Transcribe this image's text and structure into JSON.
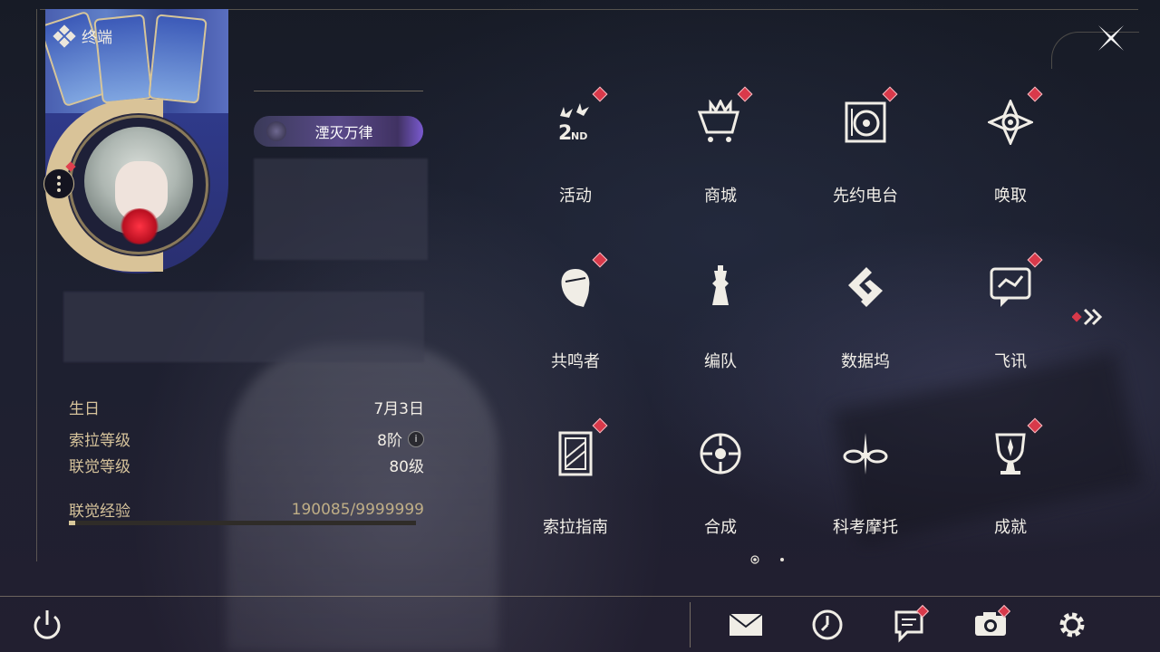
{
  "header": {
    "title": "终端"
  },
  "profile": {
    "title_badge": "湮灭万律",
    "stats": [
      {
        "label": "生日",
        "value": "7月3日"
      },
      {
        "label": "索拉等级",
        "value": "8阶"
      },
      {
        "label": "联觉等级",
        "value": "80级"
      },
      {
        "label": "联觉经验",
        "value": "190085/9999999"
      }
    ],
    "exp_progress_fraction": 0.019
  },
  "menu": {
    "items": [
      {
        "label": "活动",
        "icon": "activity-2nd-icon",
        "badge": true
      },
      {
        "label": "商城",
        "icon": "shop-cart-icon",
        "badge": true
      },
      {
        "label": "先约电台",
        "icon": "radio-station-icon",
        "badge": true
      },
      {
        "label": "唤取",
        "icon": "summon-compass-icon",
        "badge": true
      },
      {
        "label": "共鸣者",
        "icon": "resonator-portrait-icon",
        "badge": true
      },
      {
        "label": "编队",
        "icon": "team-chess-icon",
        "badge": false
      },
      {
        "label": "数据坞",
        "icon": "data-bank-icon",
        "badge": false
      },
      {
        "label": "飞讯",
        "icon": "chat-message-icon",
        "badge": true
      },
      {
        "label": "索拉指南",
        "icon": "guidebook-icon",
        "badge": true
      },
      {
        "label": "合成",
        "icon": "synthesis-icon",
        "badge": false
      },
      {
        "label": "科考摩托",
        "icon": "motorbike-icon",
        "badge": false
      },
      {
        "label": "成就",
        "icon": "trophy-icon",
        "badge": true
      }
    ],
    "page": {
      "current": 1,
      "total": 2
    }
  },
  "bottom_bar": {
    "buttons": [
      "power-icon",
      "mail-icon",
      "clock-icon",
      "notice-icon",
      "camera-icon",
      "settings-gear-icon"
    ]
  },
  "colors": {
    "accent_gold": "#d6c39b",
    "badge_red": "#d8394a"
  }
}
